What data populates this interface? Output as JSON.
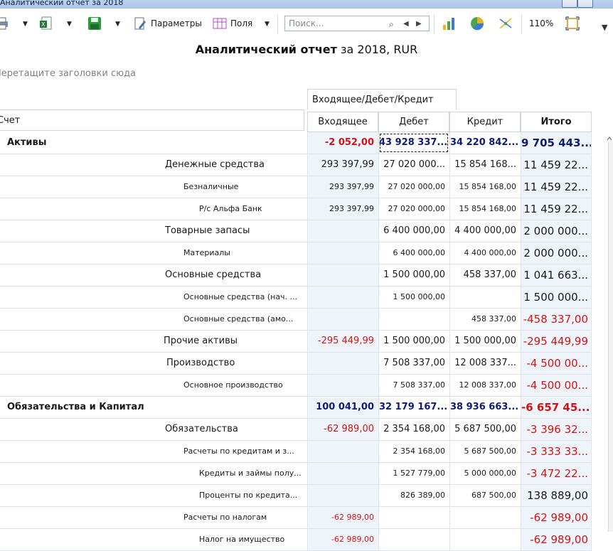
{
  "window": {
    "title": "Аналитический отчет за 2018"
  },
  "toolbar": {
    "params_label": "Параметры",
    "fields_label": "Поля",
    "search_placeholder": "Поиск...",
    "zoom": "110%",
    "dd_arrow": "▼",
    "search_glyph": "⌕",
    "prev_glyph": "◀",
    "next_glyph": "▶"
  },
  "report": {
    "title_main": "Аналитический отчет",
    "title_rest": " за 2018, RUR"
  },
  "grouping": {
    "hint": "Перетащите заголовки сюда"
  },
  "headers": {
    "column_group": "Входящее/Дебет/Кредит",
    "row_field": "Счет",
    "columns": [
      "Входящее",
      "Дебет",
      "Кредит",
      "Итого"
    ]
  },
  "rows": [
    {
      "level": 0,
      "label": "Активы",
      "values": [
        "-2 052,00",
        "43 928 337...",
        "34 220 842...",
        "9 705 443..."
      ],
      "neg": [
        true,
        false,
        false,
        false
      ]
    },
    {
      "level": 1,
      "label": "Денежные средства",
      "values": [
        "293 397,99",
        "27 020 000...",
        "15 854 168...",
        "11 459 22..."
      ],
      "neg": [
        false,
        false,
        false,
        false
      ]
    },
    {
      "level": 2,
      "label": "Безналичные",
      "values": [
        "293 397,99",
        "27 020 000,00",
        "15 854 168,00",
        "11 459 22..."
      ],
      "neg": [
        false,
        false,
        false,
        false
      ]
    },
    {
      "level": 3,
      "label": "Р/с Альфа Банк",
      "values": [
        "293 397,99",
        "27 020 000,00",
        "15 854 168,00",
        "11 459 22..."
      ],
      "neg": [
        false,
        false,
        false,
        false
      ]
    },
    {
      "level": 1,
      "label": "Товарные запасы",
      "values": [
        "",
        "6 400 000,00",
        "4 400 000,00",
        "2 000 000..."
      ],
      "neg": [
        false,
        false,
        false,
        false
      ]
    },
    {
      "level": 2,
      "label": "Материалы",
      "values": [
        "",
        "6 400 000,00",
        "4 400 000,00",
        "2 000 000..."
      ],
      "neg": [
        false,
        false,
        false,
        false
      ]
    },
    {
      "level": 1,
      "label": "Основные средства",
      "values": [
        "",
        "1 500 000,00",
        "458 337,00",
        "1 041 663..."
      ],
      "neg": [
        false,
        false,
        false,
        false
      ]
    },
    {
      "level": 2,
      "label": "Основные средства (нач. ...",
      "values": [
        "",
        "1 500 000,00",
        "",
        "1 500 000..."
      ],
      "neg": [
        false,
        false,
        false,
        false
      ]
    },
    {
      "level": 2,
      "label": "Основные средства (амо...",
      "values": [
        "",
        "",
        "458 337,00",
        "-458 337,00"
      ],
      "neg": [
        false,
        false,
        false,
        true
      ]
    },
    {
      "level": 1,
      "label": "Прочие активы",
      "values": [
        "-295 449,99",
        "1 500 000,00",
        "1 500 000,00",
        "-295 449,99"
      ],
      "neg": [
        true,
        false,
        false,
        true
      ]
    },
    {
      "level": 1,
      "label": "Производство",
      "values": [
        "",
        "7 508 337,00",
        "12 008 337...",
        "-4 500 00..."
      ],
      "neg": [
        false,
        false,
        false,
        true
      ]
    },
    {
      "level": 2,
      "label": "Основное производство",
      "values": [
        "",
        "7 508 337,00",
        "12 008 337,00",
        "-4 500 00..."
      ],
      "neg": [
        false,
        false,
        false,
        true
      ]
    },
    {
      "level": 0,
      "label": "Обязательства и Капитал",
      "values": [
        "100 041,00",
        "32 179 167...",
        "38 936 663...",
        "-6 657 45..."
      ],
      "neg": [
        false,
        false,
        false,
        true
      ]
    },
    {
      "level": 1,
      "label": "Обязательства",
      "values": [
        "-62 989,00",
        "2 354 168,00",
        "5 687 500,00",
        "-3 396 32..."
      ],
      "neg": [
        true,
        false,
        false,
        true
      ]
    },
    {
      "level": 2,
      "label": "Расчеты по кредитам и з...",
      "values": [
        "",
        "2 354 168,00",
        "5 687 500,00",
        "-3 333 33..."
      ],
      "neg": [
        false,
        false,
        false,
        true
      ]
    },
    {
      "level": 3,
      "label": "Кредиты и займы полу...",
      "values": [
        "",
        "1 527 779,00",
        "5 000 000,00",
        "-3 472 22..."
      ],
      "neg": [
        false,
        false,
        false,
        true
      ]
    },
    {
      "level": 3,
      "label": "Проценты по кредита...",
      "values": [
        "",
        "826 389,00",
        "687 500,00",
        "138 889,00"
      ],
      "neg": [
        false,
        false,
        false,
        false
      ]
    },
    {
      "level": 2,
      "label": "Расчеты по налогам",
      "values": [
        "-62 989,00",
        "",
        "",
        "-62 989,00"
      ],
      "neg": [
        true,
        false,
        false,
        true
      ]
    },
    {
      "level": 3,
      "label": "Налог на имущество",
      "values": [
        "-62 989,00",
        "",
        "",
        "-62 989,00"
      ],
      "neg": [
        true,
        false,
        false,
        true
      ]
    }
  ],
  "colors": {
    "negative": "#d31313",
    "bold_value": "#101c72",
    "total_bg": "#eef4fa"
  }
}
